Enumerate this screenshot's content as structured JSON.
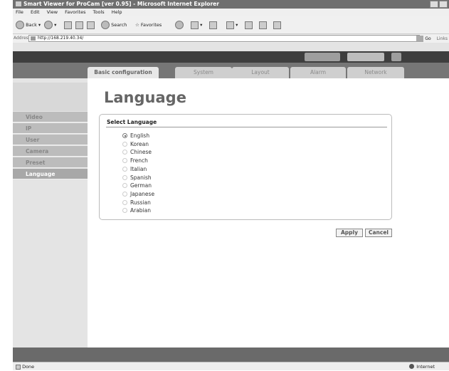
{
  "window": {
    "title": "Smart Viewer for ProCam [ver 0.95] - Microsoft Internet Explorer"
  },
  "menu": [
    "File",
    "Edit",
    "View",
    "Favorites",
    "Tools",
    "Help"
  ],
  "toolbar": {
    "back_label": "Back",
    "search_label": "Search",
    "favorites_label": "Favorites"
  },
  "address": {
    "label": "Address",
    "url": "http://168.219.40.34/",
    "go_label": "Go",
    "links_label": "Links"
  },
  "tabs": [
    "Basic configuration",
    "System",
    "Layout",
    "Alarm",
    "Network"
  ],
  "sidebar": {
    "items": [
      "Video",
      "IP",
      "User",
      "Camera",
      "Preset",
      "Language"
    ],
    "active_index": 5
  },
  "main": {
    "heading": "Language",
    "panel_title": "Select Language",
    "languages": [
      "English",
      "Korean",
      "Chinese",
      "French",
      "Italian",
      "Spanish",
      "German",
      "Japanese",
      "Russian",
      "Arabian"
    ],
    "selected": "English",
    "apply_label": "Apply",
    "cancel_label": "Cancel"
  },
  "status": {
    "left": "Done",
    "zone": "Internet"
  }
}
